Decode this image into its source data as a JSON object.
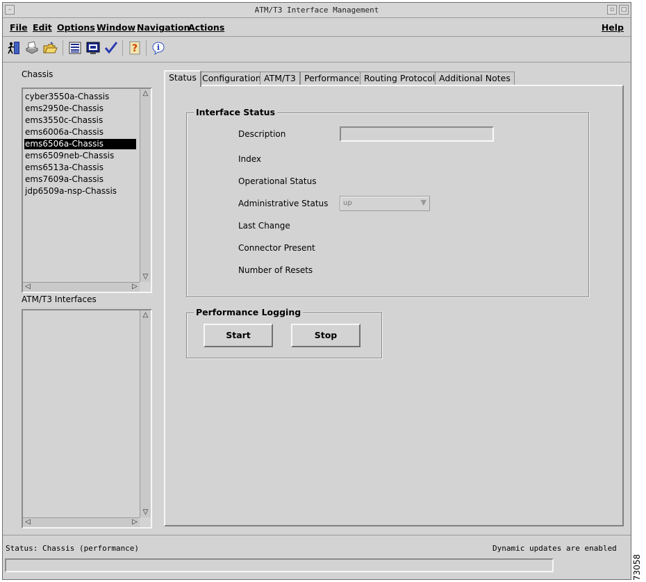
{
  "window": {
    "title": "ATM/T3 Interface Management",
    "buttons": {
      "minimize": "–",
      "restore": "▫",
      "maximize": "□"
    }
  },
  "menu": {
    "items": [
      "File",
      "Edit",
      "Options",
      "Window",
      "Navigation",
      "Actions"
    ],
    "help": "Help"
  },
  "toolbar": {
    "icons": [
      "exit-icon",
      "print-icon",
      "open-folder-icon",
      "list-icon",
      "screen-icon",
      "checkmark-icon",
      "help-icon",
      "info-icon"
    ]
  },
  "chassis": {
    "label": "Chassis",
    "items": [
      "cyber3550a-Chassis",
      "ems2950e-Chassis",
      "ems3550c-Chassis",
      "ems6006a-Chassis",
      "ems6506a-Chassis",
      "ems6509neb-Chassis",
      "ems6513a-Chassis",
      "ems7609a-Chassis",
      "jdp6509a-nsp-Chassis"
    ],
    "selected": "ems6506a-Chassis"
  },
  "interfaces": {
    "label": "ATM/T3 Interfaces",
    "items": []
  },
  "tabs": [
    "Status",
    "Configuration",
    "ATM/T3",
    "Performance",
    "Routing Protocol",
    "Additional Notes"
  ],
  "active_tab": "Status",
  "interface_status": {
    "title": "Interface Status",
    "fields": {
      "description": "Description",
      "index": "Index",
      "operational": "Operational Status",
      "administrative": "Administrative Status",
      "last_change": "Last Change",
      "connector": "Connector Present",
      "resets": "Number of Resets"
    },
    "description_value": "",
    "administrative_value": "up"
  },
  "performance_logging": {
    "title": "Performance Logging",
    "start": "Start",
    "stop": "Stop"
  },
  "status": {
    "left": "Status: Chassis (performance)",
    "right": "Dynamic updates are enabled"
  },
  "figure_code": "73058"
}
